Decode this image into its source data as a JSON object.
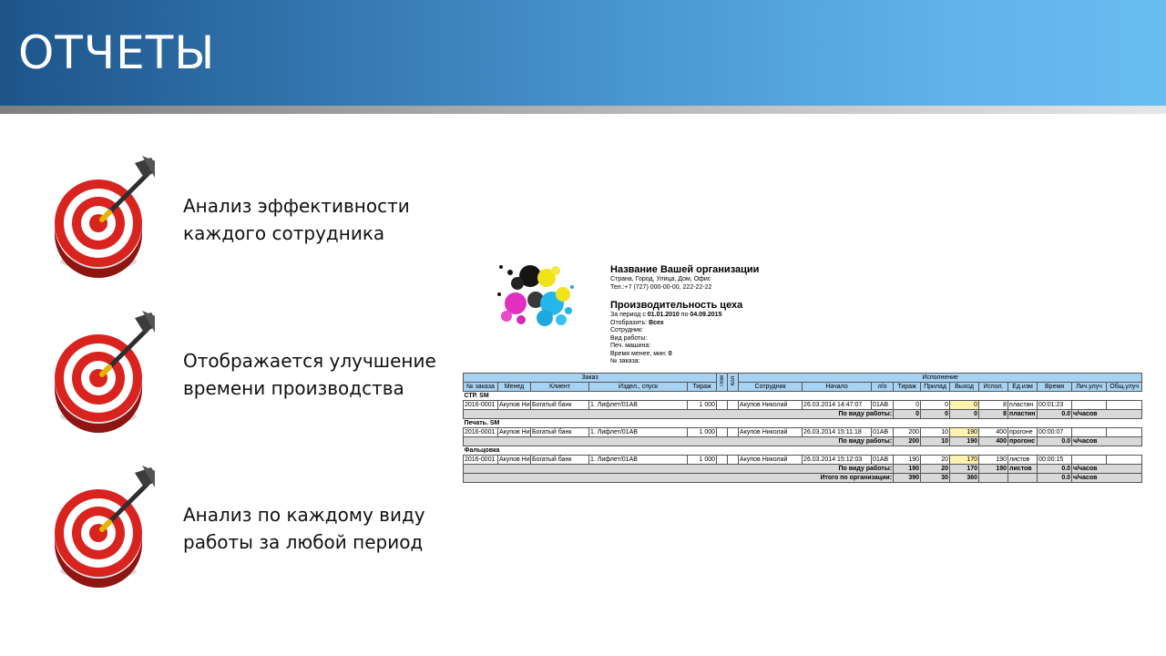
{
  "slide": {
    "title": "ОТЧЕТЫ",
    "bullets": [
      {
        "line1": "Анализ эффективности",
        "line2": "каждого сотрудника"
      },
      {
        "line1": "Отображается улучшение",
        "line2": "времени производства"
      },
      {
        "line1": "Анализ по каждому виду",
        "line2": "работы за любой период"
      }
    ]
  },
  "colors": {
    "header_dark": "#1d5589",
    "header_light": "#68bdf2",
    "target_red": "#d9231f",
    "table_header": "#a8d2f2",
    "highlight": "#fff3b0"
  },
  "report": {
    "org_name": "Название Вашей организации",
    "org_address": "Страна, Город, Улица, Дом, Офис",
    "org_phone": "Тел.:+7 (727) 000-00-00, 222-22-22",
    "title": "Производительность цеха",
    "period_prefix": "За период с",
    "period_from": "01.01.2010",
    "period_mid": "по",
    "period_to": "04.09.2015",
    "display_label": "Отобразить:",
    "display_value": "Всех",
    "filters": [
      "Сотрудник:",
      "Вид работы:",
      "Печ. машина:"
    ],
    "time_label": "Время менее, мин:",
    "time_value": "0",
    "order_label": "№ заказа:",
    "table": {
      "group_order": "Заказ",
      "group_exec": "Исполнение",
      "vert1": "Пом",
      "vert2": "Кол",
      "columns": [
        "№ заказа",
        "Менед",
        "Клиент",
        "Издел., спуск",
        "Тираж",
        "Сотрудник",
        "Начало",
        "л/о",
        "Тираж",
        "Прилад",
        "Выход",
        "Испол.",
        "Ед.изм",
        "Время",
        "Лич.улуч",
        "Общ.улуч"
      ],
      "sections": [
        {
          "name": "СТР. SM",
          "row": [
            "2016-0001",
            "Акупов Ни",
            "Богатый банк",
            "1. Лифлет/01АВ",
            "1 000",
            "Акупов Николай",
            "26.03.2014 14:47:07",
            "01АВ",
            "0",
            "0",
            "0",
            "8",
            "пластин",
            "00:01:23",
            "",
            ""
          ],
          "subtotal": [
            "По виду работы:",
            "0",
            "0",
            "0",
            "8",
            "пластин",
            "0.0",
            "ч/часов"
          ]
        },
        {
          "name": "Печать. SM",
          "row": [
            "2016-0001",
            "Акупов Ни",
            "Богатый банк",
            "1. Лифлет/01АВ",
            "1 000",
            "Акупов Николай",
            "26.03.2014 15:11:18",
            "01АВ",
            "200",
            "10",
            "190",
            "400",
            "прогоне",
            "00:00:07",
            "",
            ""
          ],
          "subtotal": [
            "По виду работы:",
            "200",
            "10",
            "190",
            "400",
            "прогонс",
            "0.0",
            "ч/часов"
          ]
        },
        {
          "name": "Фальцовка",
          "row": [
            "2016-0001",
            "Акупов Ни",
            "Богатый банк",
            "1. Лифлет/01АВ",
            "1 000",
            "Акупов Николай",
            "26.03.2014 15:12:03",
            "01АВ",
            "190",
            "20",
            "170",
            "190",
            "листов",
            "00:00:15",
            "",
            ""
          ],
          "subtotal": [
            "По виду работы:",
            "190",
            "20",
            "170",
            "190",
            "листов",
            "0.0",
            "ч/часов"
          ]
        }
      ],
      "grand_total": [
        "Итого по организации:",
        "390",
        "30",
        "360",
        "",
        "",
        "0.0",
        "ч/часов"
      ]
    }
  }
}
